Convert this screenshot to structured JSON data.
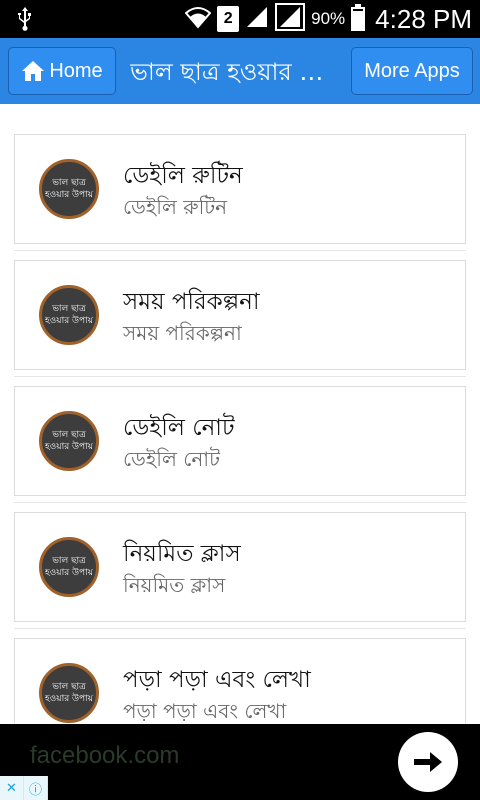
{
  "status_bar": {
    "battery_percent": "90%",
    "battery_level": 0.9,
    "time": "4:28 PM",
    "sim_label": "2",
    "icons": [
      "usb-icon",
      "wifi-icon",
      "signal-icon",
      "signal-icon",
      "battery-charging-icon"
    ]
  },
  "app_bar": {
    "home_label": "Home",
    "title": "ভাল ছাত্র হওয়ার উপায়",
    "more_apps_label": "More Apps",
    "color": "#2b86e3"
  },
  "list": [
    {
      "title": "ডেইলি রুটিন",
      "subtitle": "ডেইলি রুটিন"
    },
    {
      "title": "সময় পরিকল্পনা",
      "subtitle": "সময় পরিকল্পনা"
    },
    {
      "title": "ডেইলি নোট",
      "subtitle": "ডেইলি নোট"
    },
    {
      "title": "নিয়মিত ক্লাস",
      "subtitle": "নিয়মিত ক্লাস"
    },
    {
      "title": "পড়া পড়া এবং লেখা",
      "subtitle": "পড়া পড়া এবং লেখা"
    }
  ],
  "avatar_text": "ভাল ছাত্র হওয়ার উপায়",
  "ad": {
    "text": "facebook.com",
    "ad_choices_icons": [
      "close-icon",
      "info-icon"
    ]
  }
}
